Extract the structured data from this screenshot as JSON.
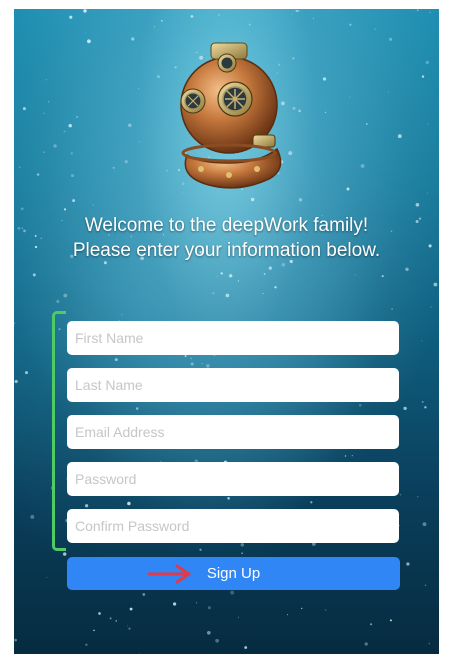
{
  "welcome": {
    "line1": "Welcome to the deepWork family!",
    "line2": "Please enter your information below."
  },
  "form": {
    "first_name_placeholder": "First Name",
    "last_name_placeholder": "Last Name",
    "email_placeholder": "Email Address",
    "password_placeholder": "Password",
    "confirm_password_placeholder": "Confirm Password",
    "submit_label": "Sign Up"
  },
  "colors": {
    "ocean_top": "#1f8fb2",
    "ocean_bottom": "#062b40",
    "button_blue": "#2f86f4",
    "bracket_green": "#4ecb63",
    "arrow_red": "#e23a4a"
  },
  "icons": {
    "logo": "diving-helmet-icon",
    "annotation_arrow": "arrow-right-icon"
  }
}
